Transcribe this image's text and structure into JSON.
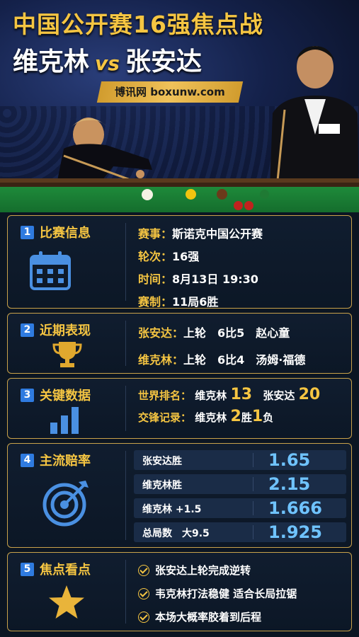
{
  "header": {
    "title_line1": "中国公开赛16强焦点战",
    "player_a": "维克林",
    "vs": "vs",
    "player_b": "张安达",
    "brand": "博讯网 boxunw.com"
  },
  "sections": {
    "match_info": {
      "number": "1",
      "title": "比赛信息",
      "icon": "calendar-icon",
      "rows": [
        {
          "label": "赛事：",
          "value": "斯诺克中国公开赛"
        },
        {
          "label": "轮次：",
          "value": "16强"
        },
        {
          "label": "时间：",
          "value": "8月13日 19:30"
        },
        {
          "label": "赛制：",
          "value": "11局6胜"
        }
      ]
    },
    "recent_form": {
      "number": "2",
      "title": "近期表现",
      "icon": "trophy-icon",
      "rows": [
        {
          "label": "张安达：",
          "value": "上轮　6比5　赵心童"
        },
        {
          "label": "维克林：",
          "value": "上轮　6比4　汤姆·福德"
        }
      ]
    },
    "key_data": {
      "number": "3",
      "title": "关键数据",
      "icon": "bar-chart-icon",
      "ranking_label": "世界排名：",
      "ranking_a_name": "维克林",
      "ranking_a_value": "13",
      "ranking_b_name": "张安达",
      "ranking_b_value": "20",
      "h2h_label": "交锋记录：",
      "h2h_name": "维克林",
      "h2h_wins": "2",
      "h2h_wins_unit": "胜",
      "h2h_losses": "1",
      "h2h_losses_unit": "负"
    },
    "odds": {
      "number": "4",
      "title": "主流赔率",
      "icon": "target-icon",
      "rows": [
        {
          "label": "张安达胜",
          "value": "1.65"
        },
        {
          "label": "维克林胜",
          "value": "2.15"
        },
        {
          "label": "维克林 +1.5",
          "value": "1.666"
        },
        {
          "label": "总局数　大9.5",
          "value": "1.925"
        }
      ]
    },
    "focus": {
      "number": "5",
      "title": "焦点看点",
      "icon": "star-icon",
      "items": [
        "张安达上轮完成逆转",
        "韦克林打法稳健 适合长局拉锯",
        "本场大概率胶着到后程"
      ]
    }
  },
  "colors": {
    "gold": "#f5c542",
    "blue": "#2f7be0",
    "odds_value": "#6fc3ff",
    "card_border": "#c9a24a"
  }
}
